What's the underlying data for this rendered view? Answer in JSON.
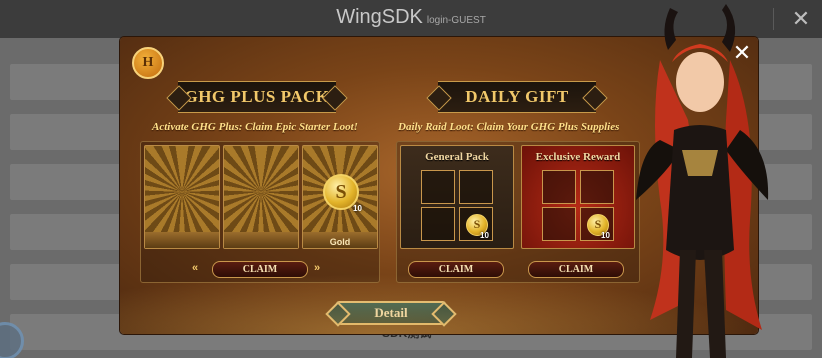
{
  "sdk": {
    "title": "WingSDK",
    "subtitle": "login-GUEST",
    "close_icon": "close-icon",
    "bottom_label": "SDK测试"
  },
  "popup": {
    "brand_logo_text": "H",
    "close_icon": "close-icon",
    "left": {
      "banner": "GHG PLUS PACK",
      "subtitle": "Activate GHG Plus: Claim Epic Starter Loot!",
      "slots": [
        {
          "label": ""
        },
        {
          "label": ""
        },
        {
          "label": "Gold",
          "coin_symbol": "S",
          "quantity": "10"
        }
      ],
      "claim_label": "CLAIM"
    },
    "right": {
      "banner": "DAILY GIFT",
      "subtitle": "Daily Raid Loot: Claim Your GHG Plus Supplies",
      "packs": [
        {
          "title": "General Pack",
          "coin_symbol": "S",
          "quantity": "10",
          "claim_label": "CLAIM"
        },
        {
          "title": "Exclusive Reward",
          "coin_symbol": "S",
          "quantity": "10",
          "claim_label": "CLAIM"
        }
      ]
    },
    "detail_label": "Detail"
  },
  "colors": {
    "accent_gold": "#f1c86a",
    "popup_bg": "#7a4418",
    "exclusive_red": "#b52a16",
    "detail_teal": "#2d5a54"
  }
}
